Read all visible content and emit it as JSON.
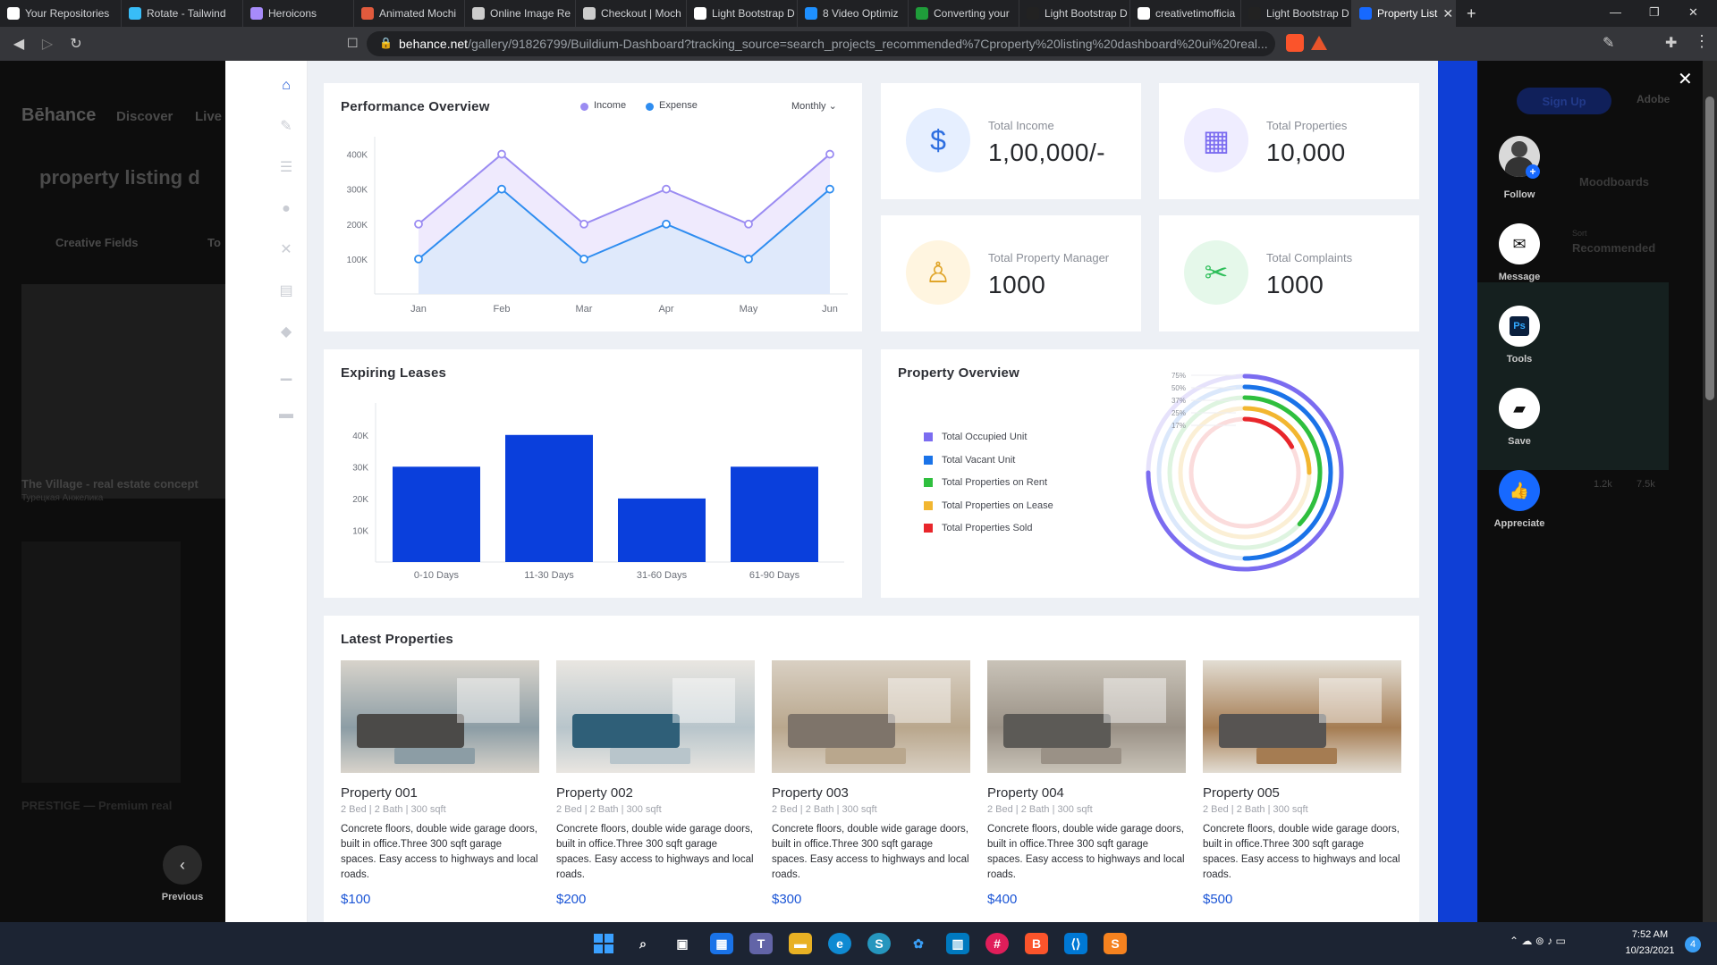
{
  "browser": {
    "tabs": [
      {
        "title": "Your Repositories",
        "color": "#ffffff"
      },
      {
        "title": "Rotate - Tailwind",
        "color": "#38bdf8"
      },
      {
        "title": "Heroicons",
        "color": "#a78bfa"
      },
      {
        "title": "Animated Mochi",
        "color": "#e05a3d"
      },
      {
        "title": "Online Image Re",
        "color": "#cccccc"
      },
      {
        "title": "Checkout | Moch",
        "color": "#cccccc"
      },
      {
        "title": "Light Bootstrap D",
        "color": "#ffffff"
      },
      {
        "title": "8 Video Optimiz",
        "color": "#1e90ff"
      },
      {
        "title": "Converting your",
        "color": "#1f9d3a"
      },
      {
        "title": "Light Bootstrap D",
        "color": "#222222"
      },
      {
        "title": "creativetimofficia",
        "color": "#ffffff"
      },
      {
        "title": "Light Bootstrap D",
        "color": "#222222"
      },
      {
        "title": "Property List",
        "color": "#1769ff"
      }
    ],
    "url_host": "behance.net",
    "url_rest": "/gallery/91826799/Buildium-Dashboard?tracking_source=search_projects_recommended%7Cproperty%20listing%20dashboard%20ui%20real..."
  },
  "behance": {
    "logo": "Bēhance",
    "nav": [
      "Discover",
      "Live"
    ],
    "search_text": "property listing d",
    "filters": [
      "Creative Fields",
      "To"
    ],
    "signup": "Sign Up",
    "adobe": "Adobe",
    "tabs_right": [
      "Moodboards"
    ],
    "sort_label": "Sort",
    "sort_value": "Recommended",
    "project1_title": "The Village - real estate concept",
    "project1_author": "Турецкая Анжелика",
    "project2_title": "PRESTIGE — Premium real",
    "stats": [
      "1.2k",
      "7.5k"
    ],
    "actions": [
      {
        "label": "Follow"
      },
      {
        "label": "Message"
      },
      {
        "label": "Tools"
      },
      {
        "label": "Save"
      },
      {
        "label": "Appreciate"
      }
    ],
    "previous": "Previous"
  },
  "dashboard": {
    "performance": {
      "title": "Performance Overview",
      "legend": [
        "Income",
        "Expense"
      ],
      "period": "Monthly"
    },
    "stats": [
      {
        "label": "Total Income",
        "value": "1,00,000/-",
        "icon": "coins-icon",
        "bg": "#e6efff",
        "fg": "#2f6fe0"
      },
      {
        "label": "Total Properties",
        "value": "10,000",
        "icon": "building-icon",
        "bg": "#efedff",
        "fg": "#7b6cf0"
      },
      {
        "label": "Total Property Manager",
        "value": "1000",
        "icon": "manager-icon",
        "bg": "#fff5e0",
        "fg": "#e0a52a"
      },
      {
        "label": "Total Complaints",
        "value": "1000",
        "icon": "tools-icon",
        "bg": "#e5f8ea",
        "fg": "#2fbf5b"
      }
    ],
    "leases": {
      "title": "Expiring Leases"
    },
    "property_overview": {
      "title": "Property Overview",
      "legend": [
        {
          "label": "Total Occupied Unit",
          "color": "#7b6cf0"
        },
        {
          "label": "Total Vacant Unit",
          "color": "#1a73e8"
        },
        {
          "label": "Total Properties on Rent",
          "color": "#2fbf3e"
        },
        {
          "label": "Total Properties on Lease",
          "color": "#f2b630"
        },
        {
          "label": "Total Properties Sold",
          "color": "#e8262b"
        }
      ],
      "ring_labels": [
        "75%",
        "50%",
        "37%",
        "25%",
        "17%"
      ]
    },
    "latest": {
      "title": "Latest Properties",
      "items": [
        {
          "name": "Property 001",
          "meta": "2 Bed | 2 Bath | 300 sqft",
          "desc": "Concrete floors, double wide garage doors, built in office.Three 300 sqft garage spaces. Easy access to highways and local roads.",
          "price": "$100"
        },
        {
          "name": "Property 002",
          "meta": "2 Bed | 2 Bath | 300 sqft",
          "desc": "Concrete floors, double wide garage doors, built in office.Three 300 sqft garage spaces. Easy access to highways and local roads.",
          "price": "$200"
        },
        {
          "name": "Property 003",
          "meta": "2 Bed | 2 Bath | 300 sqft",
          "desc": "Concrete floors, double wide garage doors, built in office.Three 300 sqft garage spaces. Easy access to highways and local roads.",
          "price": "$300"
        },
        {
          "name": "Property 004",
          "meta": "2 Bed | 2 Bath | 300 sqft",
          "desc": "Concrete floors, double wide garage doors, built in office.Three 300 sqft garage spaces. Easy access to highways and local roads.",
          "price": "$400"
        },
        {
          "name": "Property 005",
          "meta": "2 Bed | 2 Bath | 300 sqft",
          "desc": "Concrete floors, double wide garage doors, built in office.Three 300 sqft garage spaces. Easy access to highways and local roads.",
          "price": "$500"
        }
      ]
    }
  },
  "chart_data": [
    {
      "type": "area",
      "categories": [
        "Jan",
        "Feb",
        "Mar",
        "Apr",
        "May",
        "Jun"
      ],
      "ytick_labels": [
        "100K",
        "200K",
        "300K",
        "400K"
      ],
      "ylim": [
        0,
        450000
      ],
      "series": [
        {
          "name": "Income",
          "values": [
            200000,
            400000,
            200000,
            300000,
            200000,
            400000
          ],
          "color": "#9b8cf2"
        },
        {
          "name": "Expense",
          "values": [
            100000,
            300000,
            100000,
            200000,
            100000,
            300000
          ],
          "color": "#2f8df0"
        }
      ]
    },
    {
      "type": "bar",
      "categories": [
        "0-10 Days",
        "11-30 Days",
        "31-60 Days",
        "61-90 Days"
      ],
      "values": [
        30000,
        40000,
        20000,
        30000
      ],
      "ytick_labels": [
        "10K",
        "20K",
        "30K",
        "40K"
      ],
      "ylim": [
        0,
        45000
      ],
      "color": "#0a3fdc"
    },
    {
      "type": "pie",
      "categories": [
        "Total Occupied Unit",
        "Total Vacant Unit",
        "Total Properties on Rent",
        "Total Properties on Lease",
        "Total Properties Sold"
      ],
      "values": [
        75,
        50,
        37,
        25,
        17
      ]
    }
  ],
  "taskbar": {
    "time": "7:52 AM",
    "date": "10/23/2021",
    "badge": "4"
  }
}
